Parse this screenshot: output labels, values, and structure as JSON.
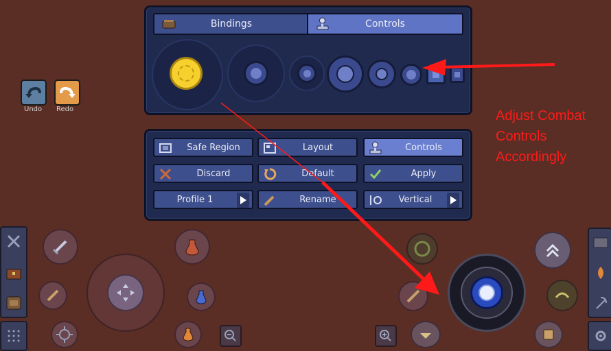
{
  "top_tabs": {
    "bindings_label": "Bindings",
    "controls_label": "Controls"
  },
  "undo_redo": {
    "undo_label": "Undo",
    "redo_label": "Redo"
  },
  "settings_panel": {
    "safe_region_label": "Safe Region",
    "layout_label": "Layout",
    "controls_label": "Controls",
    "discard_label": "Discard",
    "default_label": "Default",
    "apply_label": "Apply",
    "profile_label": "Profile 1",
    "rename_label": "Rename",
    "vertical_label": "Vertical"
  },
  "annotation": {
    "line1": "Adjust Combat",
    "line2": "Controls",
    "line3": "Accordingly"
  },
  "colors": {
    "background": "#5a2e24",
    "panel": "#1f2a4e",
    "tab_active": "#5f74c4",
    "annotation": "#ff1a1a",
    "selected_size": "#f6d02c"
  }
}
